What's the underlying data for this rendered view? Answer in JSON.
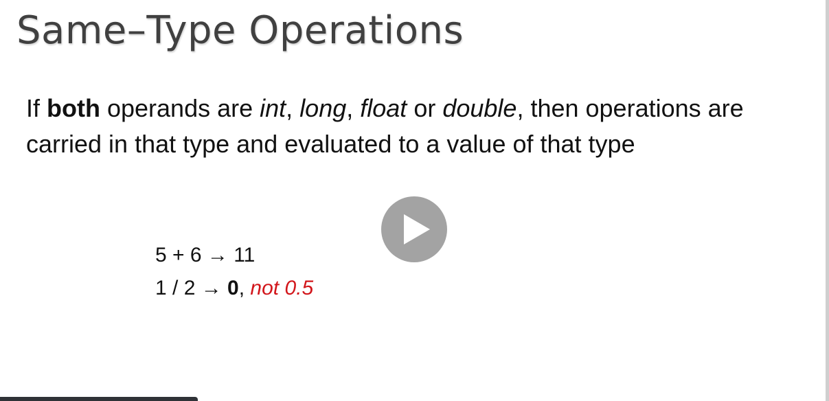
{
  "slide": {
    "title": "Same–Type Operations",
    "body": {
      "w1": "If ",
      "w2": "both",
      "w3": " operands are ",
      "w4": "int",
      "w5": ", ",
      "w6": "long",
      "w7": ", ",
      "w8": "float",
      "w9": " or ",
      "w10": "double",
      "w11": ", then operations are carried in that type and evaluated to a value of that type"
    },
    "examples": {
      "line1": "5 + 6 → 11",
      "line2_expr": "1 / 2 → ",
      "line2_result": "0",
      "line2_sep": ", ",
      "line2_note": "not 0.5"
    }
  },
  "player": {
    "play_icon": "play-icon"
  },
  "colors": {
    "title": "#404040",
    "note": "#d2161b",
    "play_button": "#969696"
  }
}
